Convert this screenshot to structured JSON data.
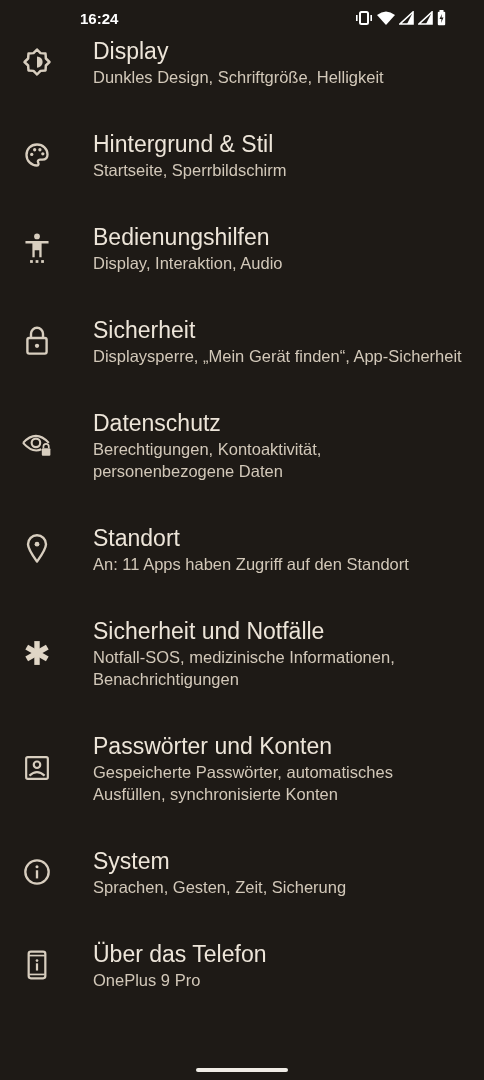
{
  "status_bar": {
    "time": "16:24"
  },
  "settings": [
    {
      "title": "Display",
      "subtitle": "Dunkles Design, Schriftgröße, Helligkeit"
    },
    {
      "title": "Hintergrund & Stil",
      "subtitle": "Startseite, Sperrbildschirm"
    },
    {
      "title": "Bedienungshilfen",
      "subtitle": "Display, Interaktion, Audio"
    },
    {
      "title": "Sicherheit",
      "subtitle": "Displaysperre, „Mein Gerät finden“, App-Sicherheit"
    },
    {
      "title": "Datenschutz",
      "subtitle": "Berechtigungen, Kontoaktivität, personenbezogene Daten"
    },
    {
      "title": "Standort",
      "subtitle": "An: 11 Apps haben Zugriff auf den Standort"
    },
    {
      "title": "Sicherheit und Notfälle",
      "subtitle": "Notfall-SOS, medizinische Informationen, Benachrichtigungen"
    },
    {
      "title": "Passwörter und Konten",
      "subtitle": "Gespeicherte Passwörter, automatisches Ausfüllen, synchronisierte Konten"
    },
    {
      "title": "System",
      "subtitle": "Sprachen, Gesten, Zeit, Sicherung"
    },
    {
      "title": "Über das Telefon",
      "subtitle": "OnePlus 9 Pro"
    }
  ]
}
